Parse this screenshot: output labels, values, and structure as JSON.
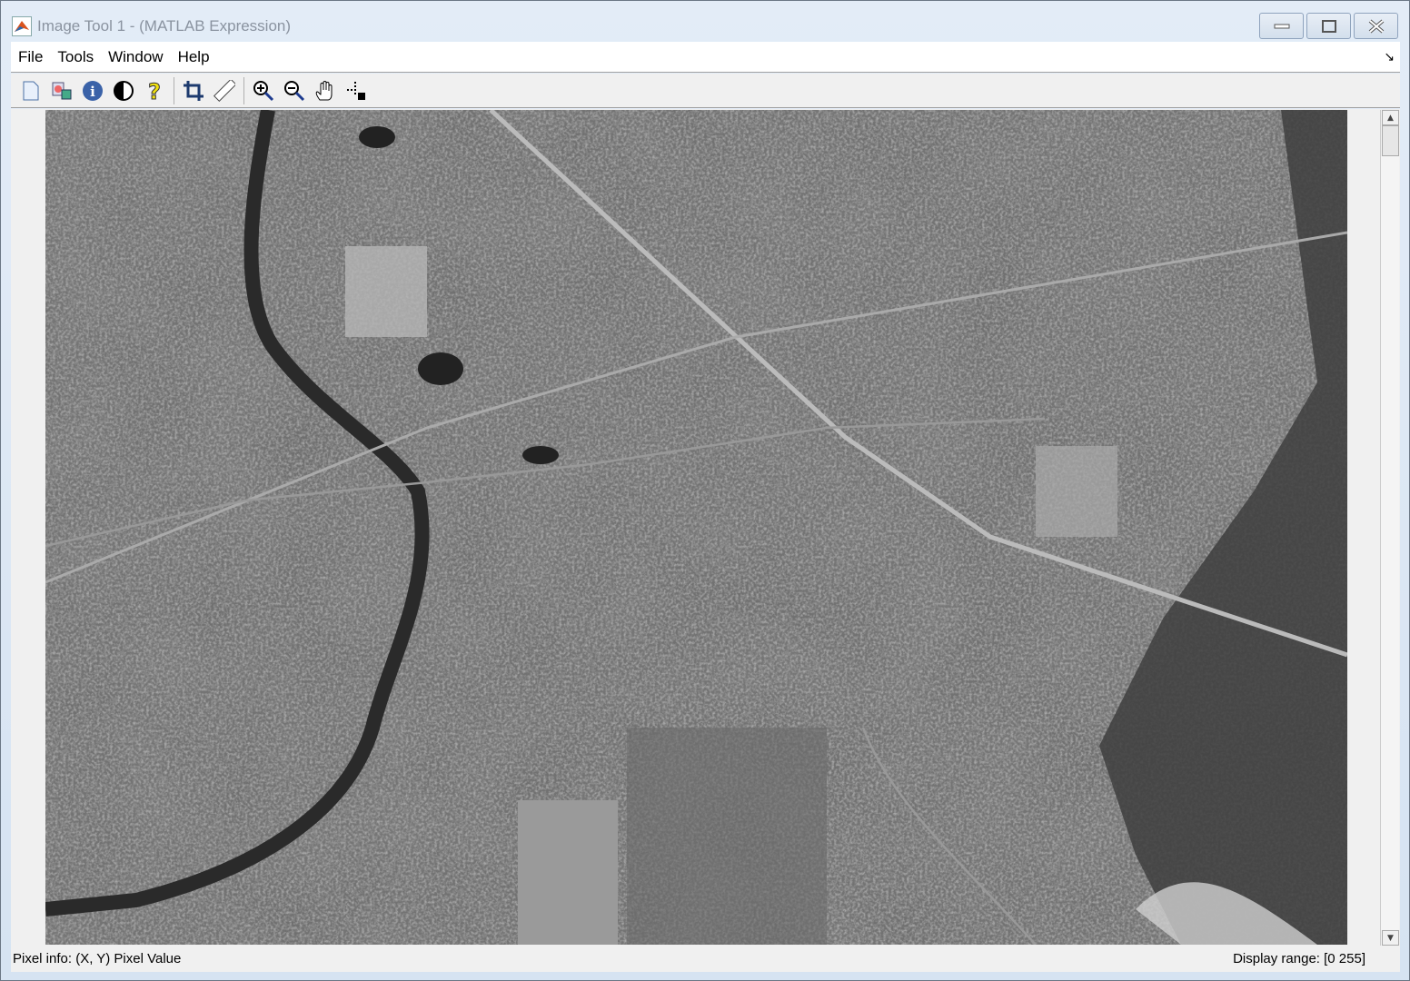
{
  "window": {
    "title": "Image Tool 1 - (MATLAB Expression)"
  },
  "menu": [
    "File",
    "Tools",
    "Window",
    "Help"
  ],
  "toolbar": [
    "new-figure-icon",
    "export-icon",
    "image-info-icon",
    "contrast-icon",
    "help-icon",
    "crop-icon",
    "distance-ruler-icon",
    "zoom-in-icon",
    "zoom-out-icon",
    "pan-hand-icon",
    "pixel-region-icon"
  ],
  "status": {
    "pixel_info": "Pixel info: (X, Y)  Pixel Value",
    "display_range": "Display range: [0 255]"
  }
}
